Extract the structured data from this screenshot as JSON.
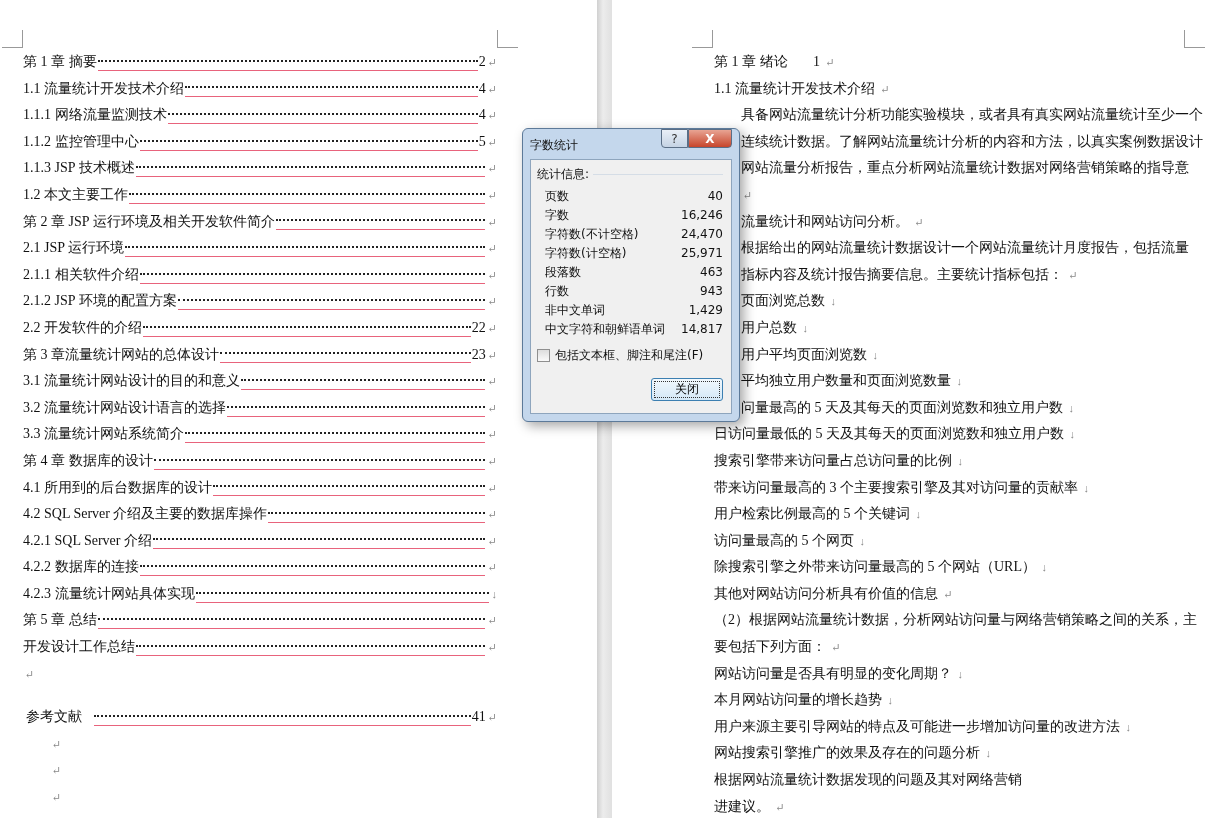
{
  "left_page": {
    "toc": [
      {
        "title": "第 1 章  摘要",
        "page": "2",
        "mark": "↵"
      },
      {
        "title": "1.1 流量统计开发技术介绍",
        "page": "4",
        "mark": "↵"
      },
      {
        "title": "1.1.1 网络流量监测技术",
        "page": "4",
        "mark": "↵"
      },
      {
        "title": "1.1.2 监控管理中心",
        "page": "5",
        "mark": "↵"
      },
      {
        "title": "1.1.3 JSP 技术概述",
        "mark": "↵"
      },
      {
        "title": "1.2  本文主要工作",
        "mark": "↵"
      },
      {
        "title": "第 2 章  JSP 运行环境及相关开发软件简介",
        "mark": "↵"
      },
      {
        "title": "2.1 JSP 运行环境",
        "mark": "↵"
      },
      {
        "title": "2.1.1  相关软件介绍",
        "mark": "↵"
      },
      {
        "title": "2.1.2 JSP 环境的配置方案",
        "mark": "↵"
      },
      {
        "title": "2.2  开发软件的介绍",
        "page": "22",
        "mark": "↵"
      },
      {
        "title": "第 3 章流量统计网站的总体设计",
        "page": "23",
        "mark": "↵"
      },
      {
        "title": "3.1  流量统计网站设计的目的和意义",
        "mark": "↵"
      },
      {
        "title": "3.2  流量统计网站设计语言的选择",
        "mark": "↵"
      },
      {
        "title": "3.3  流量统计网站系统简介",
        "mark": "↵"
      },
      {
        "title": "第 4 章  数据库的设计",
        "mark": "↵"
      },
      {
        "title": "4.1  所用到的后台数据库的设计",
        "mark": "↵"
      },
      {
        "title": "4.2 SQL Server 介绍及主要的数据库操作",
        "mark": "↵"
      },
      {
        "title": "4.2.1 SQL Server 介绍",
        "mark": "↵"
      },
      {
        "title": "4.2.2  数据库的连接",
        "mark": "↵"
      },
      {
        "title": "4.2.3 流量统计网站具体实现",
        "mark": "↓"
      },
      {
        "title": "第 5 章  总结",
        "mark": "↵"
      },
      {
        "title": "开发设计工作总结",
        "mark": "↵"
      }
    ],
    "blank_mark": "↵",
    "references": {
      "title": "参考文献",
      "page": "41",
      "mark": "↵"
    },
    "trailing_marks": [
      "↵",
      "↵",
      "↵"
    ]
  },
  "right_page": {
    "chapter": {
      "title": "第 1 章  绪论",
      "page": "1",
      "mark": "↵"
    },
    "section": {
      "text": "1.1 流量统计开发技术介绍",
      "mark": "↵"
    },
    "lines_beside_dialog": [
      {
        "text": "具备网站流量统计分析功能实验模块，或者具有真实网站流量统计至少一个"
      },
      {
        "text": "连续统计数据。了解网站流量统计分析的内容和方法，以真实案例数据设计"
      },
      {
        "text": "网站流量分析报告，重点分析网站流量统计数据对网络营销策略的指导意"
      },
      {
        "mark": "↵"
      },
      {
        "text": "流量统计和网站访问分析。",
        "mark": "↵"
      },
      {
        "text": "根据给出的网站流量统计数据设计一个网站流量统计月度报告，包括流量"
      },
      {
        "text": "指标内容及统计报告摘要信息。主要统计指标包括：",
        "mark": "↵"
      },
      {
        "text": "页面浏览总数",
        "mark": "↓"
      },
      {
        "text": "用户总数",
        "mark": "↓"
      },
      {
        "text": "用户平均页面浏览数",
        "mark": "↓"
      },
      {
        "text": "平均独立用户数量和页面浏览数量",
        "mark": "↓"
      },
      {
        "text": "问量最高的 5 天及其每天的页面浏览数和独立用户数",
        "mark": "↓"
      }
    ],
    "lines": [
      {
        "text": "日访问量最低的 5 天及其每天的页面浏览数和独立用户数",
        "mark": "↓"
      },
      {
        "text": "搜索引擎带来访问量占总访问量的比例",
        "mark": "↓"
      },
      {
        "text": "带来访问量最高的 3 个主要搜索引擎及其对访问量的贡献率",
        "mark": "↓"
      },
      {
        "text": "用户检索比例最高的 5 个关键词",
        "mark": "↓"
      },
      {
        "text": "访问量最高的 5 个网页",
        "mark": "↓"
      },
      {
        "text": "除搜索引擎之外带来访问量最高的 5 个网站（URL）",
        "mark": "↓"
      },
      {
        "text": "其他对网站访问分析具有价值的信息",
        "mark": "↵"
      },
      {
        "text": "（2）根据网站流量统计数据，分析网站访问量与网络营销策略之间的关系，主"
      },
      {
        "text": "要包括下列方面：",
        "mark": "↵"
      },
      {
        "text": "网站访问量是否具有明显的变化周期？",
        "mark": "↓"
      },
      {
        "text": "本月网站访问量的增长趋势",
        "mark": "↓"
      },
      {
        "text": "用户来源主要引导网站的特点及可能进一步增加访问量的改进方法",
        "mark": "↓"
      },
      {
        "text": "网站搜索引擎推广的效果及存在的问题分析",
        "mark": "↓"
      },
      {
        "text": "根据网站流量统计数据发现的问题及其对网络营销"
      },
      {
        "text": "进建议。",
        "mark": "↵"
      }
    ]
  },
  "dialog": {
    "title": "字数统计",
    "help": "?",
    "close": "X",
    "group": "统计信息:",
    "stats": [
      {
        "label": "页数",
        "value": "40"
      },
      {
        "label": "字数",
        "value": "16,246"
      },
      {
        "label": "字符数(不计空格)",
        "value": "24,470"
      },
      {
        "label": "字符数(计空格)",
        "value": "25,971"
      },
      {
        "label": "段落数",
        "value": "463"
      },
      {
        "label": "行数",
        "value": "943"
      },
      {
        "label": "非中文单词",
        "value": "1,429"
      },
      {
        "label": "中文字符和朝鲜语单词",
        "value": "14,817"
      }
    ],
    "checkbox": {
      "label": "包括文本框、脚注和尾注(F)",
      "checked": false
    },
    "button": "关闭"
  }
}
